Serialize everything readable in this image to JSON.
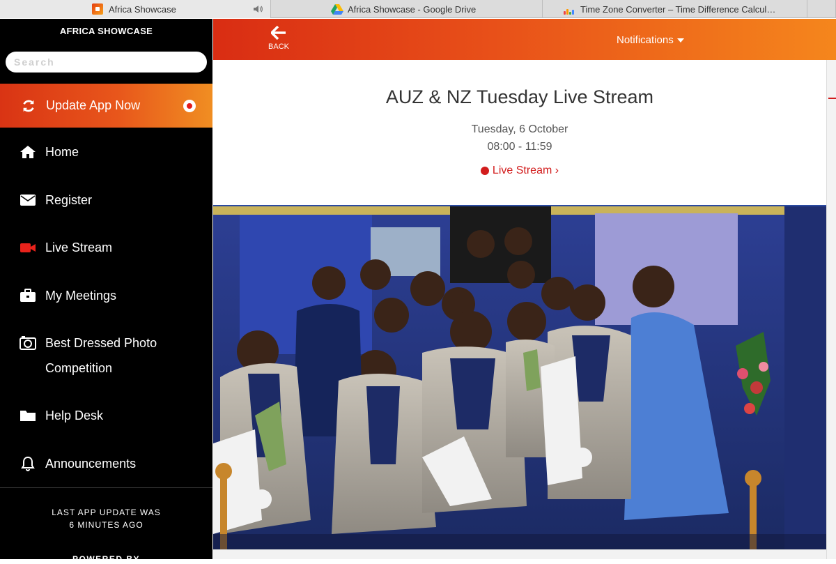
{
  "browser": {
    "tabs": [
      {
        "title": "Africa Showcase",
        "icon": "africa-showcase-icon"
      },
      {
        "title": "Africa Showcase - Google Drive",
        "icon": "google-drive-icon"
      },
      {
        "title": "Time Zone Converter – Time Difference Calcul…",
        "icon": "time-zone-converter-icon"
      },
      {
        "title": "",
        "icon": ""
      }
    ]
  },
  "sidebar": {
    "brand": "AFRICA SHOWCASE",
    "search_placeholder": "Search",
    "update_label": "Update App Now",
    "items": [
      {
        "label": "Home",
        "icon": "home-icon"
      },
      {
        "label": "Register",
        "icon": "envelope-icon"
      },
      {
        "label": "Live Stream",
        "icon": "video-camera-icon"
      },
      {
        "label": "My Meetings",
        "icon": "briefcase-icon"
      },
      {
        "label": "Best Dressed Photo Competition",
        "icon": "camera-icon"
      },
      {
        "label": "Help Desk",
        "icon": "folder-icon"
      },
      {
        "label": "Announcements",
        "icon": "bell-icon"
      }
    ],
    "last_update_line1": "LAST APP UPDATE WAS",
    "last_update_line2": "6 MINUTES AGO",
    "powered_by": "POWERED BY"
  },
  "topbar": {
    "back_label": "BACK",
    "notifications_label": "Notifications"
  },
  "event": {
    "title": "AUZ & NZ Tuesday Live Stream",
    "date": "Tuesday, 6 October",
    "time": "08:00 - 11:59",
    "link_label": "Live Stream ›"
  },
  "colors": {
    "accent_start": "#d92d13",
    "accent_end": "#f5861c",
    "sidebar_bg": "#000000",
    "live_red": "#d21c1c"
  }
}
